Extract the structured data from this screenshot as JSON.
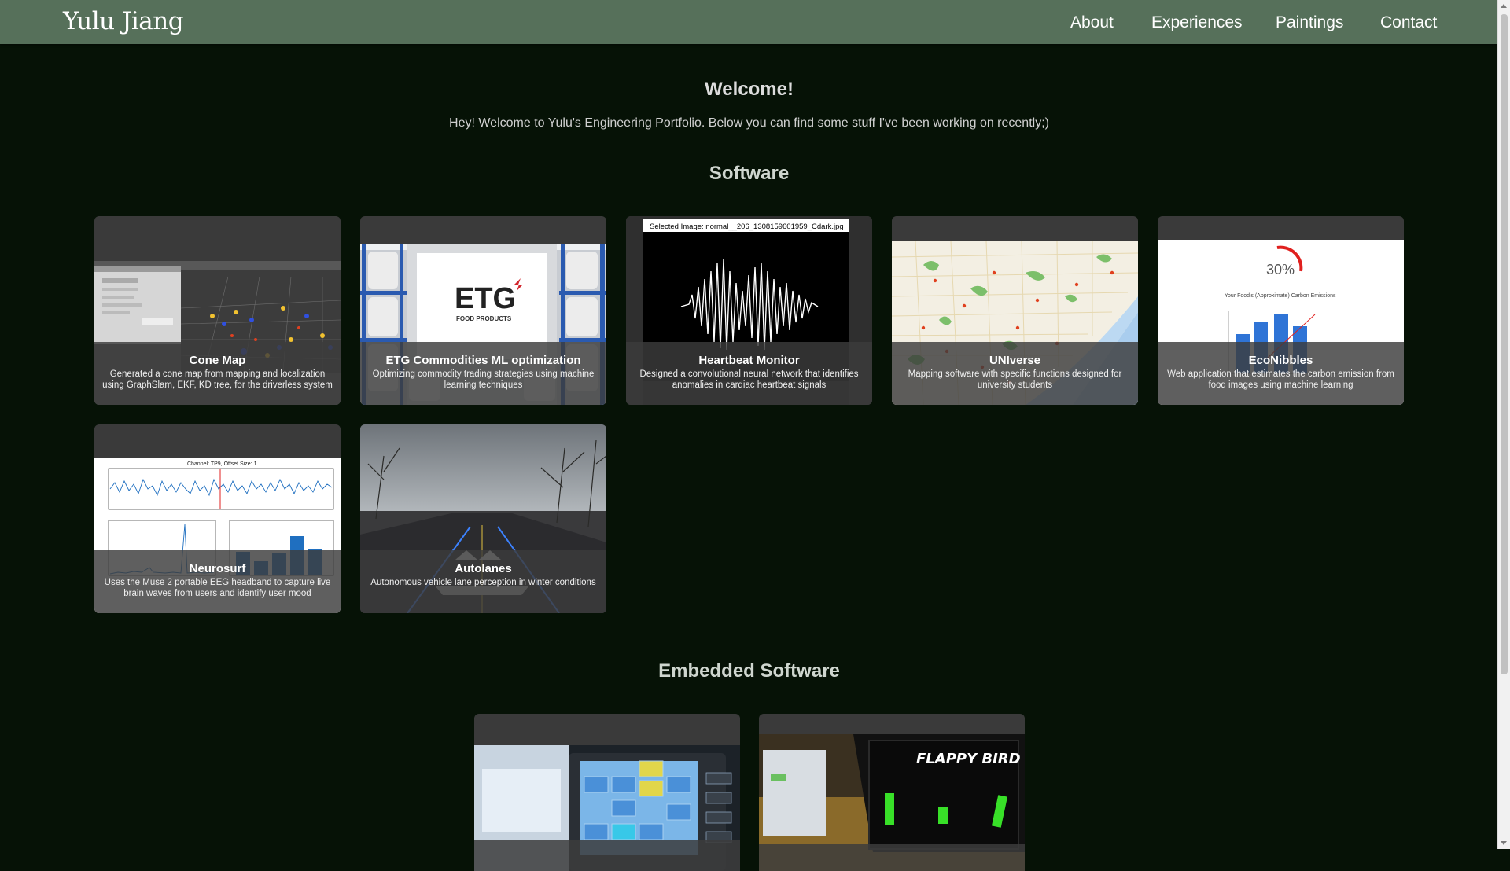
{
  "nav": {
    "brand": "Yulu Jiang",
    "links": [
      "About",
      "Experiences",
      "Paintings",
      "Contact"
    ]
  },
  "welcome": {
    "title": "Welcome!",
    "text": "Hey! Welcome to Yulu's Engineering Portfolio. Below you can find some stuff I've been working on recently;)"
  },
  "software": {
    "title": "Software",
    "projects": [
      {
        "title": "Cone Map",
        "desc": "Generated a cone map from mapping and localization using GraphSlam, EKF, KD tree, for the driverless system"
      },
      {
        "title": "ETG Commodities ML optimization",
        "desc": "Optimizing commodity trading strategies using machine learning techniques",
        "logo": "ETG",
        "logo_sub": "FOOD PRODUCTS"
      },
      {
        "title": "Heartbeat Monitor",
        "desc": "Designed a convolutional neural network that identifies anomalies in cardiac heartbeat signals",
        "image_caption": "Selected Image: normal__206_1308159601959_Cdark.jpg"
      },
      {
        "title": "UNIverse",
        "desc": "Mapping software with specific functions designed for university students"
      },
      {
        "title": "EcoNibbles",
        "desc": "Web application that estimates the carbon emission from food images using machine learning",
        "image_percent": "30%",
        "image_caption": "Your Food's (Approximate) Carbon Emissions"
      },
      {
        "title": "Neurosurf",
        "desc": "Uses the Muse 2 portable EEG headband to capture live brain waves from users and identify user mood",
        "image_caption": "Channel: TP9, Offset Size: 1"
      },
      {
        "title": "Autolanes",
        "desc": "Autonomous vehicle lane perception in winter conditions"
      }
    ]
  },
  "embedded": {
    "title": "Embedded Software",
    "projects": [
      {
        "image_text": ""
      },
      {
        "image_text": "FLAPPY BIRD"
      }
    ]
  },
  "colors": {
    "background": "#061206",
    "navbar": "#56705a",
    "card": "#3a3a3a"
  }
}
